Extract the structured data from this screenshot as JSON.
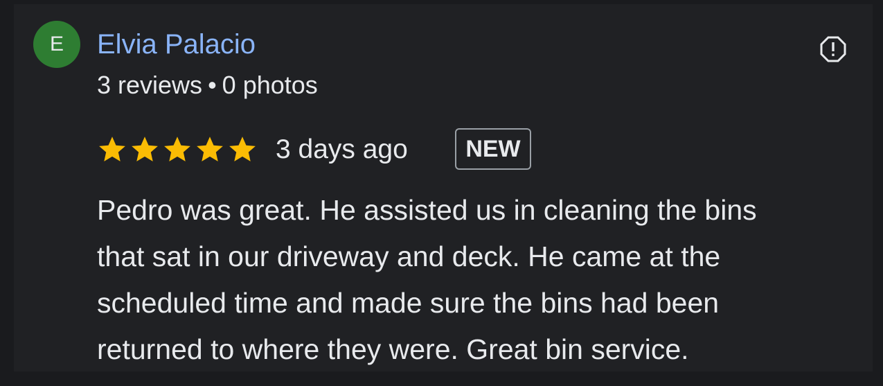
{
  "reviewer": {
    "avatar_letter": "E",
    "avatar_color": "#2e7d32",
    "name": "Elvia Palacio",
    "reviews_count": "3 reviews",
    "separator": "•",
    "photos_count": "0 photos"
  },
  "review": {
    "rating": 5,
    "max_rating": 5,
    "star_color": "#fbbc04",
    "time_ago": "3 days ago",
    "badge": "NEW",
    "text_lines": [
      "Pedro was great. He assisted us in cleaning the bins",
      "that sat in our driveway and deck. He came at the",
      "scheduled time and made sure the bins had been",
      "returned to where they were. Great bin service."
    ]
  },
  "actions": {
    "report_icon": "report-icon"
  },
  "colors": {
    "background": "#1a1b1e",
    "card": "#202124",
    "name_link": "#8ab4f8",
    "text": "#e8eaed"
  }
}
